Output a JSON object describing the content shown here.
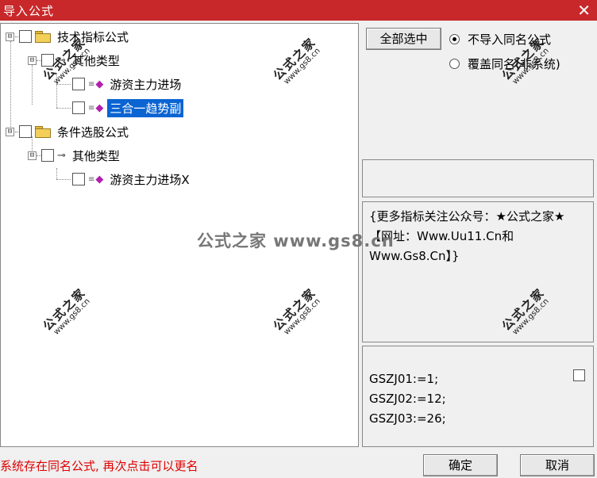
{
  "window": {
    "title": "导入公式",
    "close_icon": "✕"
  },
  "tree": {
    "groups": [
      {
        "expander": "⊟",
        "label": "技术指标公式"
      },
      {
        "expander": "⊟",
        "label": "条件选股公式"
      }
    ],
    "subgroups": [
      {
        "expander": "⊟",
        "label": "其他类型"
      },
      {
        "expander": "⊟",
        "label": "其他类型"
      }
    ],
    "items": [
      {
        "label": "游资主力进场"
      },
      {
        "label": "三合一趋势副"
      },
      {
        "label": "游资主力进场X"
      }
    ]
  },
  "select_all_label": "全部选中",
  "radio_options": [
    {
      "label": "不导入同名公式",
      "checked": true
    },
    {
      "label": "覆盖同名(非系统)",
      "checked": false
    }
  ],
  "description": "{更多指标关注公众号：★公式之家★【网址：Www.Uu11.Cn和Www.Gs8.Cn】}",
  "code_lines": [
    "GSZJ01:=1;",
    "GSZJ02:=12;",
    "GSZJ03:=26;"
  ],
  "status_text": "系统存在同名公式, 再次点击可以更名",
  "ok_label": "确定",
  "cancel_label": "取消",
  "watermark": {
    "line1": "公式之家",
    "line2": "www.gs8.cn",
    "center": "公式之家 www.gs8.cn"
  }
}
